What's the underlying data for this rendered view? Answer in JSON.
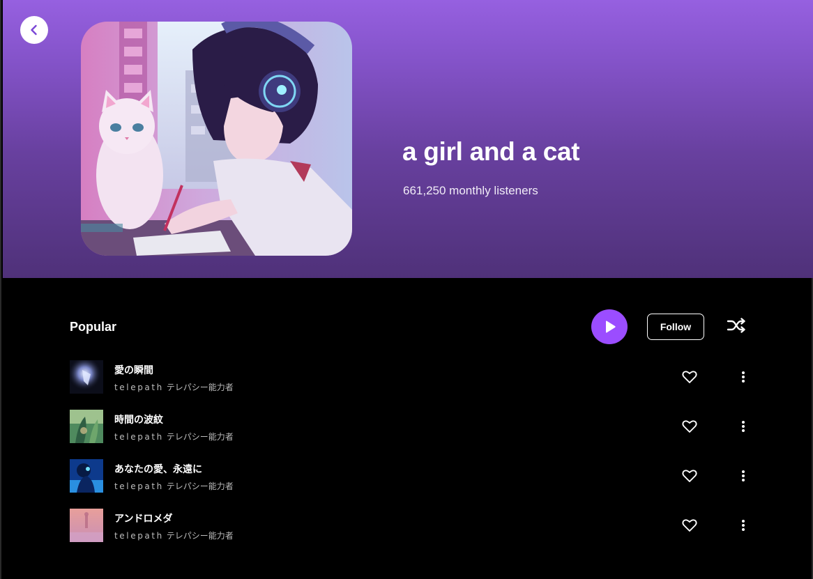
{
  "header": {
    "artist_name": "a girl and a cat",
    "monthly_listeners": "661,250 monthly listeners",
    "gradient_top": "#9660e0",
    "gradient_bottom": "#4f3179"
  },
  "popular": {
    "title": "Popular",
    "follow_label": "Follow",
    "accent_color": "#9b4dff"
  },
  "icons": {
    "back": "chevron-left-icon",
    "play": "play-icon",
    "shuffle": "shuffle-icon",
    "like": "heart-icon",
    "more": "more-vertical-icon"
  },
  "tracks": [
    {
      "title": "愛の瞬間",
      "artist_latin": "telepath",
      "artist_jp": "テレパシー能力者"
    },
    {
      "title": "時間の波紋",
      "artist_latin": "telepath",
      "artist_jp": "テレパシー能力者"
    },
    {
      "title": "あなたの愛、永遠に",
      "artist_latin": "telepath",
      "artist_jp": "テレパシー能力者"
    },
    {
      "title": "アンドロメダ",
      "artist_latin": "telepath",
      "artist_jp": "テレパシー能力者"
    }
  ]
}
